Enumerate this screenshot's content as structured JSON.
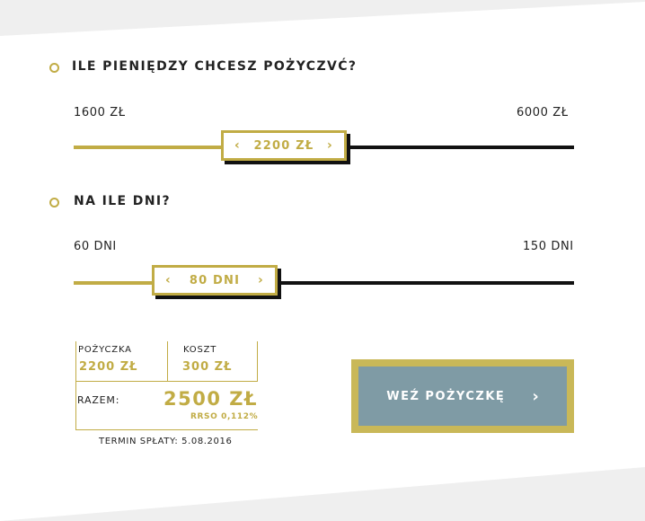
{
  "colors": {
    "accent": "#c1ac45",
    "track_dark": "#111111",
    "cta_bg": "#7f9ba5",
    "cta_border": "#c9b858"
  },
  "amount": {
    "question": "ILE PIENIĘDZY CHCESZ POŻYCZVĆ?",
    "min_label": "1600 ZŁ",
    "max_label": "6000 ZŁ",
    "value_label": "2200 ZŁ",
    "prev_icon": "chevron-left-icon",
    "next_icon": "chevron-right-icon"
  },
  "days": {
    "question": "NA ILE DNI?",
    "min_label": "60 DNI",
    "max_label": "150 DNI",
    "value_label": "80 DNI",
    "prev_icon": "chevron-left-icon",
    "next_icon": "chevron-right-icon"
  },
  "summary": {
    "loan_label": "POŻYCZKA",
    "loan_value": "2200 ZŁ",
    "cost_label": "KOSZT",
    "cost_value": "300 ZŁ",
    "total_label": "RAZEM:",
    "total_value": "2500 ZŁ",
    "rrso": "RRSO 0,112%",
    "term": "TERMIN SPŁATY: 5.08.2016"
  },
  "cta": {
    "label": "WEŹ POŻYCZKĘ",
    "icon": "chevron-right-icon"
  }
}
